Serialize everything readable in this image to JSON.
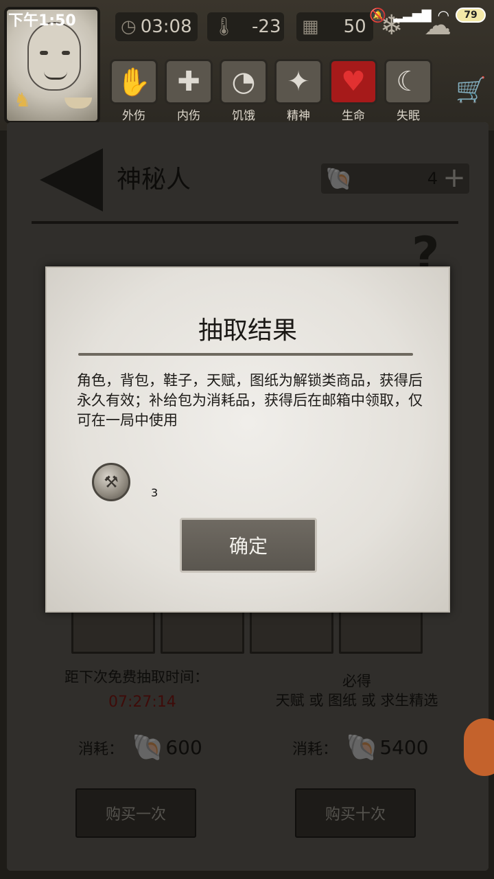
{
  "status_bar": {
    "time": "下午1:50",
    "battery": "79"
  },
  "hud": {
    "clock": "03:08",
    "temperature": "-23",
    "day": "50",
    "status_icons": [
      {
        "label": "外伤",
        "icon": "bandaged-hand-icon"
      },
      {
        "label": "内伤",
        "icon": "cross-icon"
      },
      {
        "label": "饥饿",
        "icon": "stomach-icon"
      },
      {
        "label": "精神",
        "icon": "mind-icon"
      },
      {
        "label": "生命",
        "icon": "heart-icon"
      },
      {
        "label": "失眠",
        "icon": "moon-star-icon"
      }
    ]
  },
  "header": {
    "title": "神秘人",
    "shell_count": "4"
  },
  "dialog": {
    "title": "抽取结果",
    "description": "角色，背包，鞋子，天赋，图纸为解锁类商品，获得后永久有效；补给包为消耗品，获得后在邮箱中领取，仅可在一局中使用",
    "reward_count": "3",
    "confirm_label": "确定"
  },
  "shop": {
    "free_draw_label": "距下次免费抽取时间：",
    "timer": "07:27:14",
    "guarantee_line1": "必得",
    "guarantee_line2": "天赋 或 图纸 或 求生精选",
    "cost_label": "消耗：",
    "single_cost": "600",
    "ten_cost": "5400",
    "buy_one_label": "购买一次",
    "buy_ten_label": "购买十次"
  },
  "colors": {
    "timer": "#8b1a14",
    "heart": "#a61a1a",
    "shell": "#e0b24a"
  }
}
